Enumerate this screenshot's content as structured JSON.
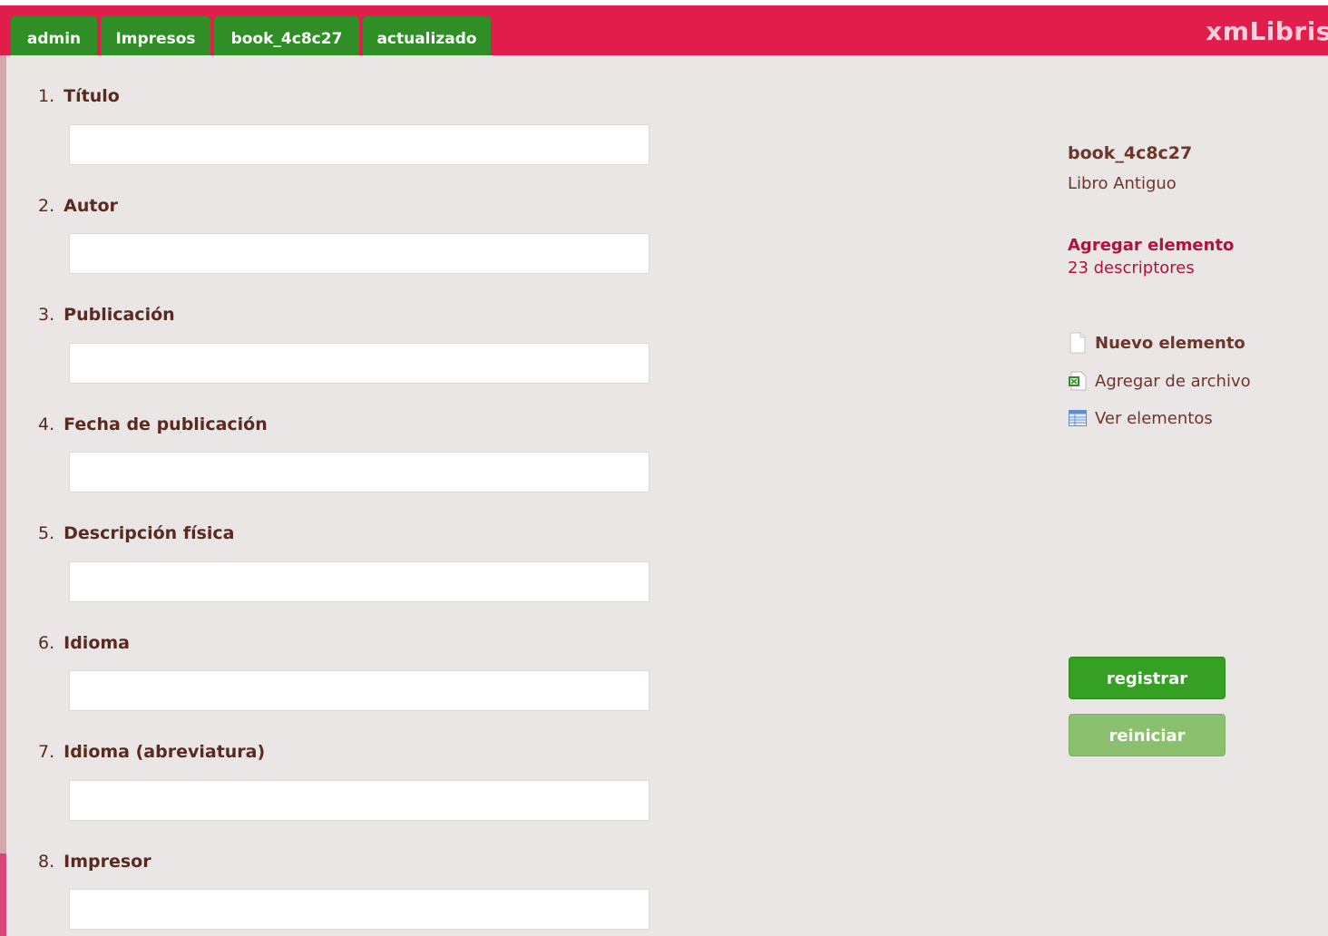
{
  "header": {
    "tabs": [
      {
        "label": "admin"
      },
      {
        "label": "Impresos"
      },
      {
        "label": "book_4c8c27"
      },
      {
        "label": "actualizado"
      }
    ],
    "brand": "xmLibris",
    "brand_color": "#e01d4b"
  },
  "form": {
    "fields": [
      {
        "number": "1.",
        "label": "Título",
        "value": ""
      },
      {
        "number": "2.",
        "label": "Autor",
        "value": ""
      },
      {
        "number": "3.",
        "label": "Publicación",
        "value": ""
      },
      {
        "number": "4.",
        "label": "Fecha de publicación",
        "value": ""
      },
      {
        "number": "5.",
        "label": "Descripción física",
        "value": ""
      },
      {
        "number": "6.",
        "label": "Idioma",
        "value": ""
      },
      {
        "number": "7.",
        "label": "Idioma (abreviatura)",
        "value": ""
      },
      {
        "number": "8.",
        "label": "Impresor",
        "value": ""
      }
    ]
  },
  "sidebar": {
    "record_id": "book_4c8c27",
    "record_type": "Libro Antiguo",
    "add_title": "Agregar elemento",
    "add_count": "23 descriptores",
    "actions": [
      {
        "label": "Nuevo elemento",
        "icon": "new-document-icon"
      },
      {
        "label": "Agregar de archivo",
        "icon": "spreadsheet-file-icon"
      },
      {
        "label": "Ver elementos",
        "icon": "table-list-icon"
      }
    ],
    "register_label": "registrar",
    "reset_label": "reiniciar"
  },
  "colors": {
    "tab_green": "#2f8e26",
    "button_green": "#35a023",
    "button_light_green": "#8bc16e",
    "label_brown": "#5a2a1f",
    "link_crimson": "#b2113b",
    "background": "#ebe6e6"
  }
}
